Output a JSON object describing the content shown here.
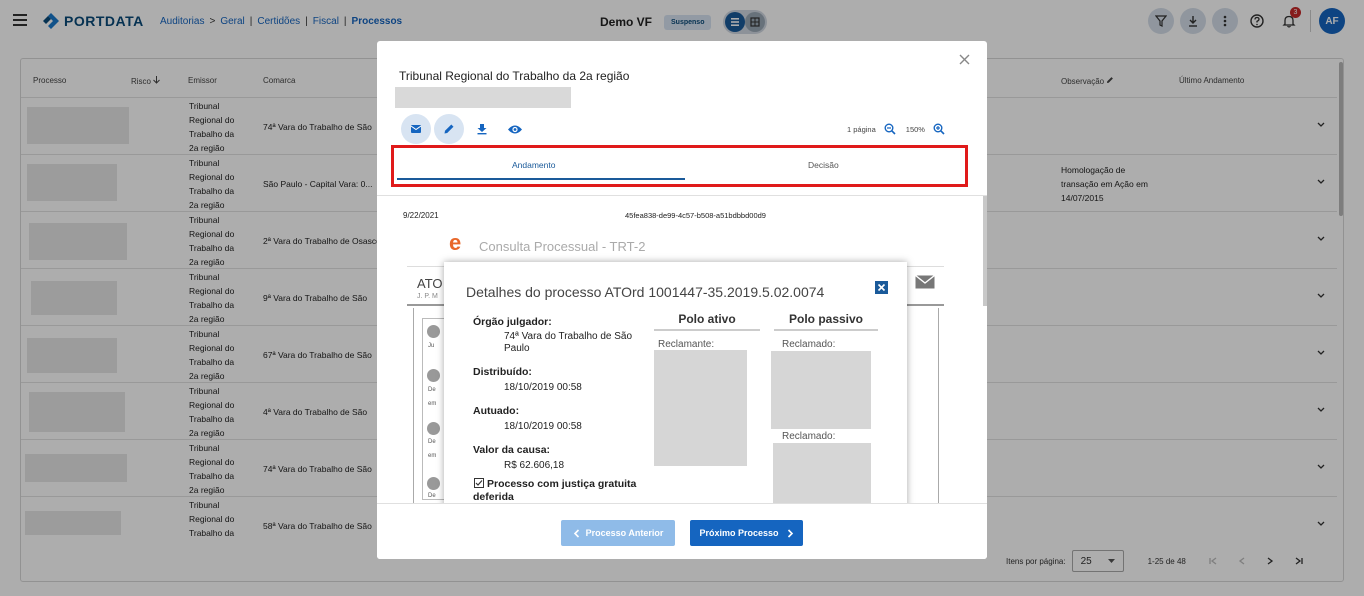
{
  "nav": {
    "brand": "PORTDATA",
    "breadcrumb": [
      "Auditorias",
      "Geral",
      "Certidões",
      "Fiscal",
      "Processos"
    ],
    "separators": [
      ">",
      "|",
      "|",
      "|"
    ],
    "app_name": "Demo VF",
    "status_badge": "Suspenso",
    "notification_count": "3",
    "avatar_initials": "AF"
  },
  "table": {
    "headers": {
      "processo": "Processo",
      "risco": "Risco",
      "emissor": "Emissor",
      "comarca": "Comarca",
      "observacao": "Observação",
      "ultimo": "Último Andamento"
    },
    "rows": [
      {
        "emissor": [
          "Tribunal",
          "Regional do",
          "Trabalho da",
          "2a região"
        ],
        "comarca": "74ª Vara do Trabalho de São",
        "obs": []
      },
      {
        "emissor": [
          "Tribunal",
          "Regional do",
          "Trabalho da",
          "2a região"
        ],
        "comarca": "São Paulo - Capital Vara: 0...",
        "obs": [
          "Homologação de",
          "transação em Ação em",
          "14/07/2015"
        ]
      },
      {
        "emissor": [
          "Tribunal",
          "Regional do",
          "Trabalho da",
          "2a região"
        ],
        "comarca": "2ª Vara do Trabalho de Osasco",
        "obs": []
      },
      {
        "emissor": [
          "Tribunal",
          "Regional do",
          "Trabalho da",
          "2a região"
        ],
        "comarca": "9ª Vara do Trabalho de São",
        "obs": []
      },
      {
        "emissor": [
          "Tribunal",
          "Regional do",
          "Trabalho da",
          "2a região"
        ],
        "comarca": "67ª Vara do Trabalho de São",
        "obs": []
      },
      {
        "emissor": [
          "Tribunal",
          "Regional do",
          "Trabalho da",
          "2a região"
        ],
        "comarca": "4ª Vara do Trabalho de São",
        "obs": []
      },
      {
        "emissor": [
          "Tribunal",
          "Regional do",
          "Trabalho da",
          "2a região"
        ],
        "comarca": "74ª Vara do Trabalho de São",
        "obs": []
      },
      {
        "emissor": [
          "Tribunal",
          "Regional do",
          "Trabalho da"
        ],
        "comarca": "58ª Vara do Trabalho de São",
        "obs": []
      }
    ]
  },
  "pagination": {
    "label": "Itens por página:",
    "per_page": "25",
    "range": "1-25 de 48"
  },
  "modal": {
    "title": "Tribunal Regional do Trabalho da 2a região",
    "pages": "1 página",
    "zoom": "150%",
    "tabs": [
      "Andamento",
      "Decisão"
    ],
    "doc": {
      "date": "9/22/2021",
      "hash": "45fea838-de99-4c57-b508-a51bdbbd00d9",
      "site_title": "Consulta Processual - TRT-2",
      "logo_letter": "e",
      "header_fragment": "ATO",
      "judge_fragment": "J. P. M",
      "side_fragments": [
        "Ju",
        "De",
        "em",
        "De",
        "em",
        "De",
        "em"
      ],
      "popup": {
        "title": "Detalhes do processo ATOrd 1001447-35.2019.5.02.0074",
        "orgao_label": "Órgão julgador:",
        "orgao_value": [
          "74ª Vara do Trabalho de São",
          "Paulo"
        ],
        "distribuido_label": "Distribuído:",
        "distribuido_value": "18/10/2019 00:58",
        "autuado_label": "Autuado:",
        "autuado_value": "18/10/2019 00:58",
        "valor_label": "Valor da causa:",
        "valor_value": "R$ 62.606,18",
        "justica_label": "Processo com justiça gratuita",
        "justica_label2": "deferida",
        "polo_ativo": "Polo ativo",
        "polo_passivo": "Polo passivo",
        "reclamante": "Reclamante:",
        "reclamado1": "Reclamado:",
        "reclamado2": "Reclamado:"
      }
    },
    "prev_button": "Processo Anterior",
    "next_button": "Próximo Processo"
  },
  "colors": {
    "primary": "#1565c0",
    "highlight": "#e01a1a",
    "brand": "#0a4a7a"
  }
}
